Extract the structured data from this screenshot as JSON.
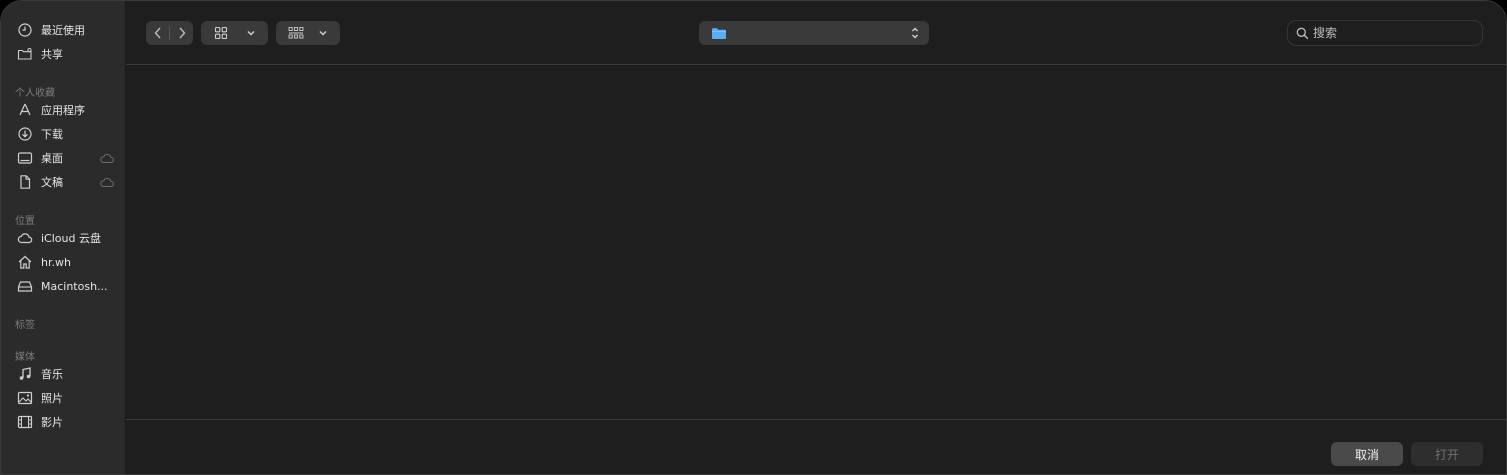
{
  "sidebar": {
    "recents_label": "最近使用",
    "shared_label": "共享",
    "favorites_heading": "个人收藏",
    "favorites": [
      {
        "label": "应用程序",
        "icon": "applications-icon",
        "cloud": false
      },
      {
        "label": "下载",
        "icon": "downloads-icon",
        "cloud": false
      },
      {
        "label": "桌面",
        "icon": "desktop-icon",
        "cloud": true
      },
      {
        "label": "文稿",
        "icon": "documents-icon",
        "cloud": true
      }
    ],
    "locations_heading": "位置",
    "locations": [
      {
        "label": "iCloud 云盘",
        "icon": "icloud-icon"
      },
      {
        "label": "hr.wh",
        "icon": "home-icon"
      },
      {
        "label": "Macintosh...",
        "icon": "disk-icon"
      }
    ],
    "tags_heading": "标签",
    "media_heading": "媒体",
    "media": [
      {
        "label": "音乐",
        "icon": "music-icon"
      },
      {
        "label": "照片",
        "icon": "photos-icon"
      },
      {
        "label": "影片",
        "icon": "movies-icon"
      }
    ]
  },
  "toolbar": {
    "path_label": "",
    "search_placeholder": "搜索"
  },
  "footer": {
    "cancel_label": "取消",
    "open_label": "打开"
  },
  "colors": {
    "folder_blue": "#5aaef5",
    "window_bg": "#1e1e1e",
    "sidebar_bg": "#2b2b2b"
  }
}
